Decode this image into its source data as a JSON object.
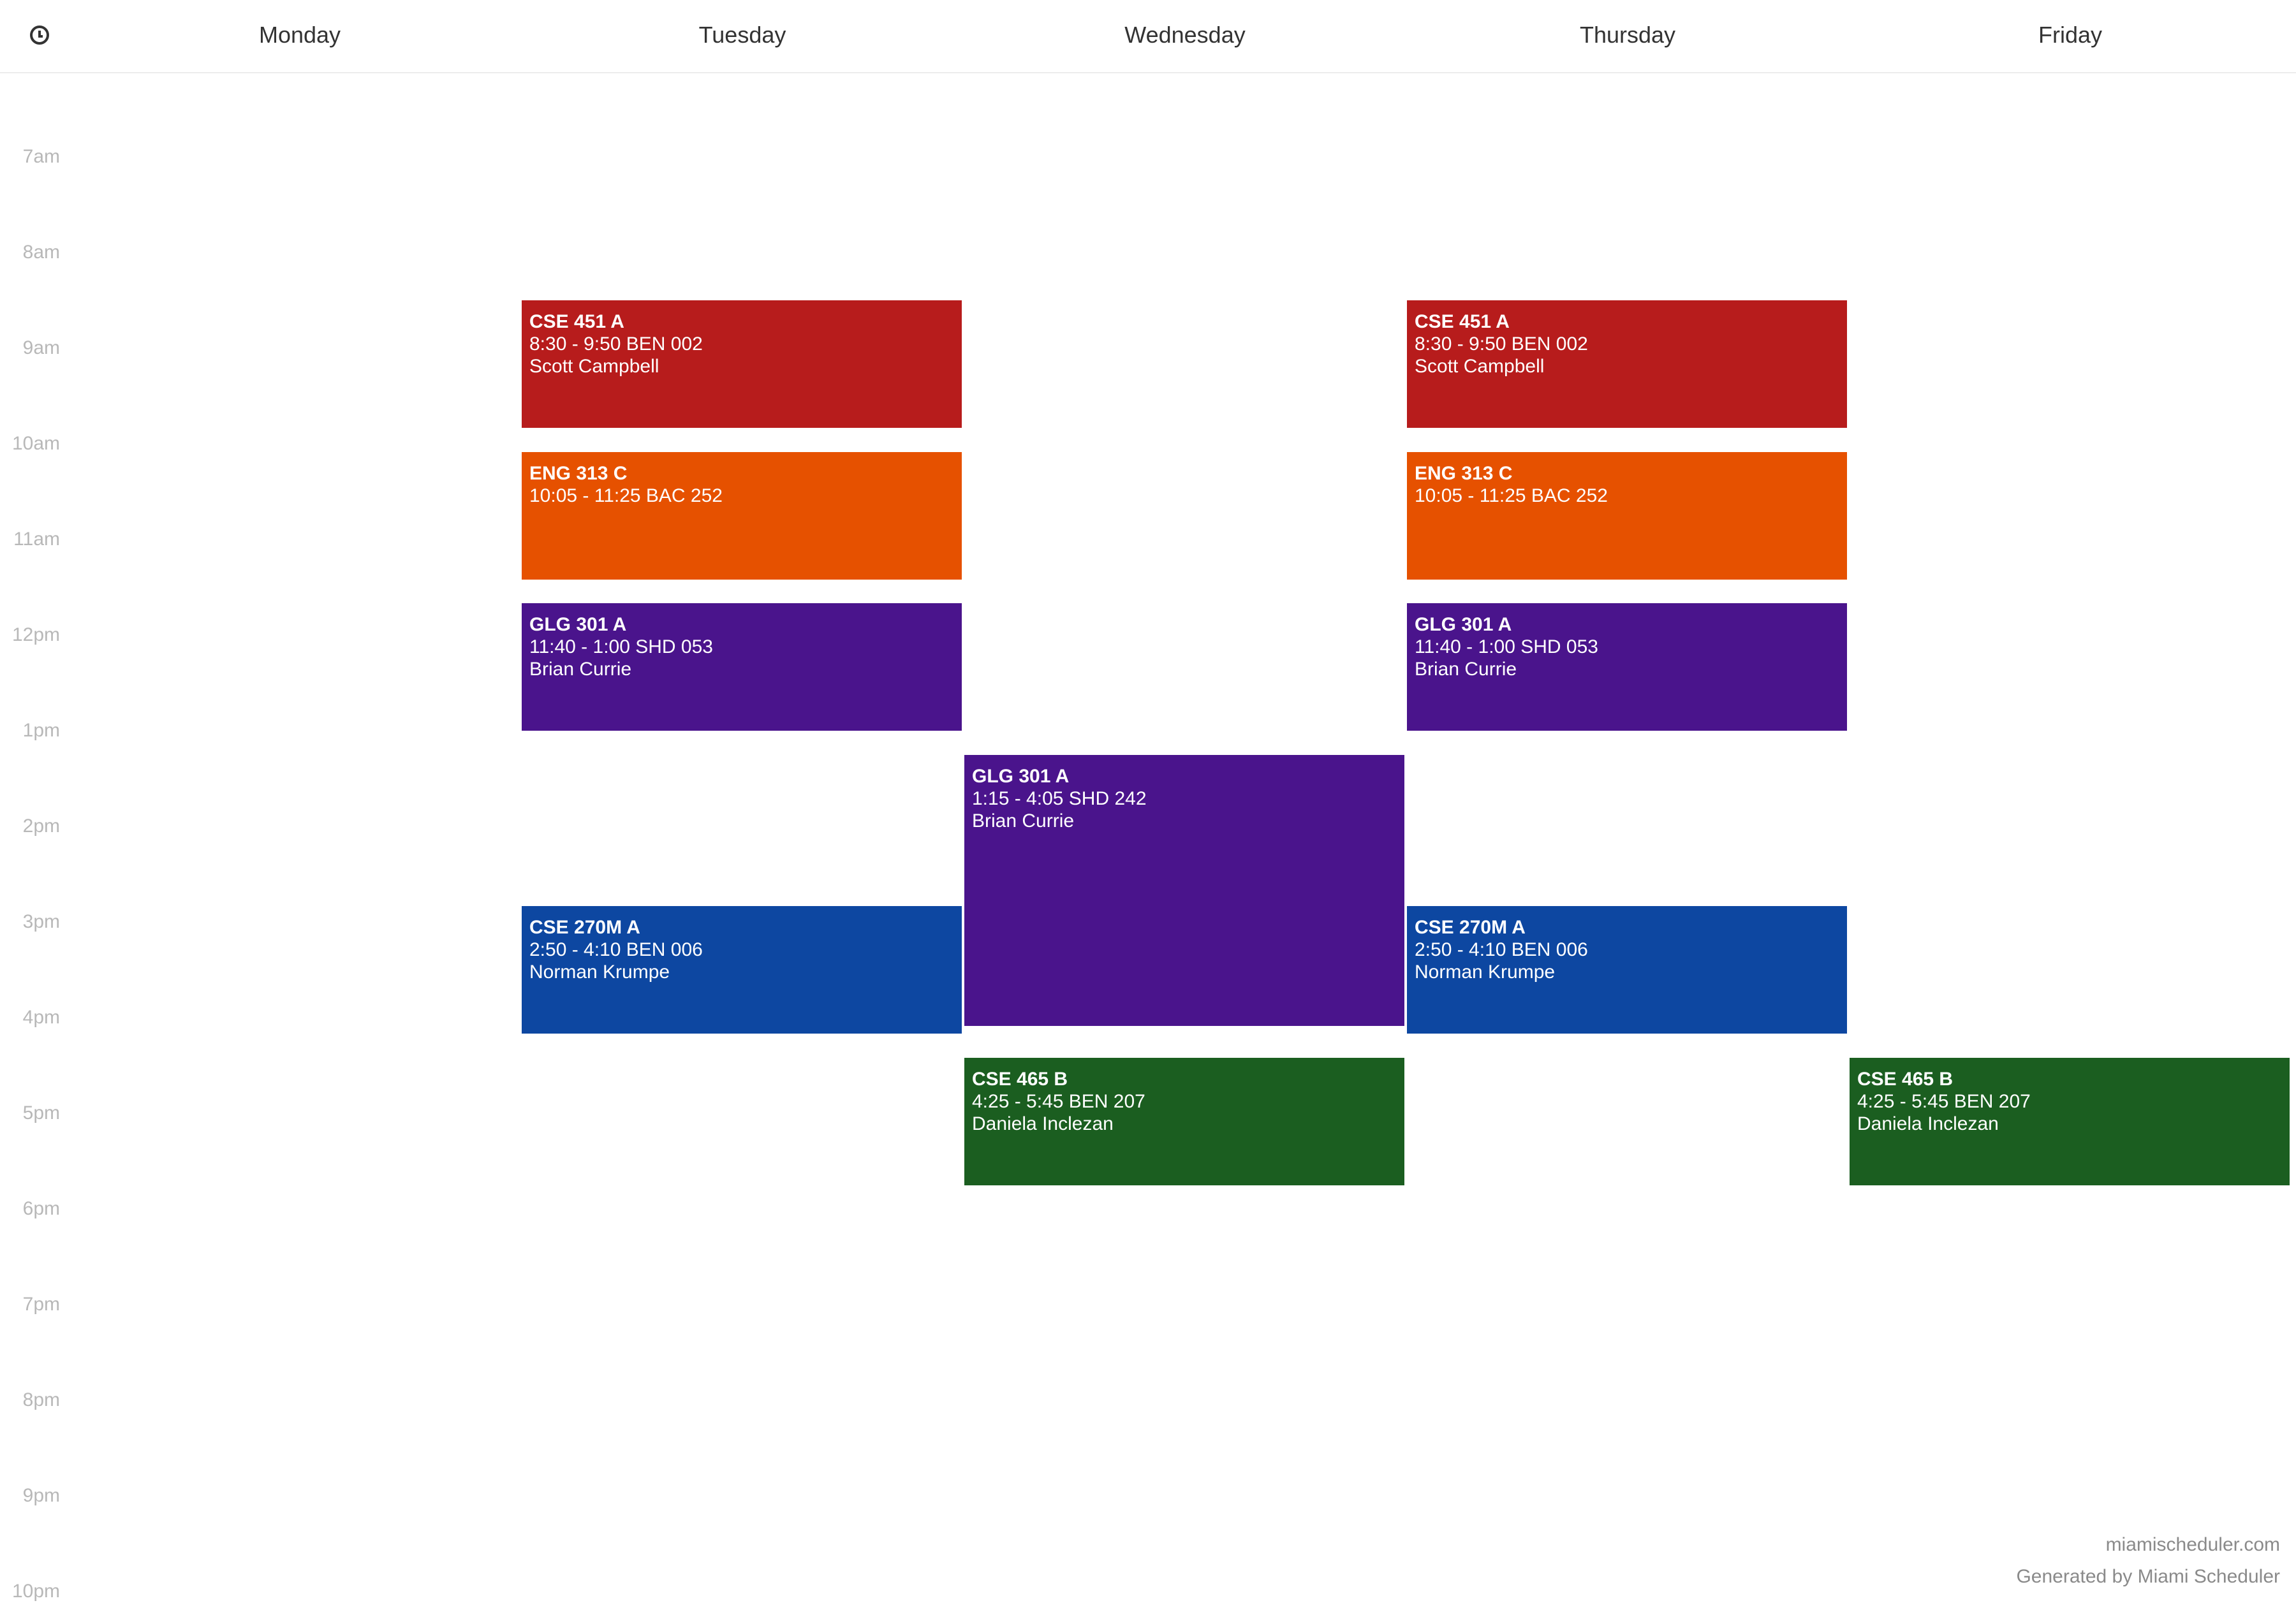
{
  "header": {
    "days": [
      "Monday",
      "Tuesday",
      "Wednesday",
      "Thursday",
      "Friday"
    ]
  },
  "time_axis": {
    "hours": [
      "7am",
      "8am",
      "9am",
      "10am",
      "11am",
      "12pm",
      "1pm",
      "2pm",
      "3pm",
      "4pm",
      "5pm",
      "6pm",
      "7pm",
      "8pm",
      "9pm",
      "10pm"
    ]
  },
  "events": [
    {
      "course": "CSE 451 A",
      "time_room": "8:30 - 9:50 BEN 002",
      "instructor": "Scott Campbell",
      "day": "Tuesday",
      "start": "8:30",
      "end": "9:50",
      "color": "#b71c1c"
    },
    {
      "course": "CSE 451 A",
      "time_room": "8:30 - 9:50 BEN 002",
      "instructor": "Scott Campbell",
      "day": "Thursday",
      "start": "8:30",
      "end": "9:50",
      "color": "#b71c1c"
    },
    {
      "course": "ENG 313 C",
      "time_room": "10:05 - 11:25 BAC 252",
      "instructor": "",
      "day": "Tuesday",
      "start": "10:05",
      "end": "11:25",
      "color": "#e65100"
    },
    {
      "course": "ENG 313 C",
      "time_room": "10:05 - 11:25 BAC 252",
      "instructor": "",
      "day": "Thursday",
      "start": "10:05",
      "end": "11:25",
      "color": "#e65100"
    },
    {
      "course": "GLG 301 A",
      "time_room": "11:40 - 1:00 SHD 053",
      "instructor": "Brian Currie",
      "day": "Tuesday",
      "start": "11:40",
      "end": "13:00",
      "color": "#4a148c"
    },
    {
      "course": "GLG 301 A",
      "time_room": "11:40 - 1:00 SHD 053",
      "instructor": "Brian Currie",
      "day": "Thursday",
      "start": "11:40",
      "end": "13:00",
      "color": "#4a148c"
    },
    {
      "course": "GLG 301 A",
      "time_room": "1:15 - 4:05 SHD 242",
      "instructor": "Brian Currie",
      "day": "Wednesday",
      "start": "13:15",
      "end": "16:05",
      "color": "#4a148c"
    },
    {
      "course": "CSE 270M A",
      "time_room": "2:50 - 4:10 BEN 006",
      "instructor": "Norman Krumpe",
      "day": "Tuesday",
      "start": "14:50",
      "end": "16:10",
      "color": "#0d47a1"
    },
    {
      "course": "CSE 270M A",
      "time_room": "2:50 - 4:10 BEN 006",
      "instructor": "Norman Krumpe",
      "day": "Thursday",
      "start": "14:50",
      "end": "16:10",
      "color": "#0d47a1"
    },
    {
      "course": "CSE 465 B",
      "time_room": "4:25 - 5:45 BEN 207",
      "instructor": "Daniela Inclezan",
      "day": "Wednesday",
      "start": "16:25",
      "end": "17:45",
      "color": "#1b5e20"
    },
    {
      "course": "CSE 465 B",
      "time_room": "4:25 - 5:45 BEN 207",
      "instructor": "Daniela Inclezan",
      "day": "Friday",
      "start": "16:25",
      "end": "17:45",
      "color": "#1b5e20"
    }
  ],
  "footer": {
    "site": "miamischeduler.com",
    "credit": "Generated by Miami Scheduler"
  }
}
